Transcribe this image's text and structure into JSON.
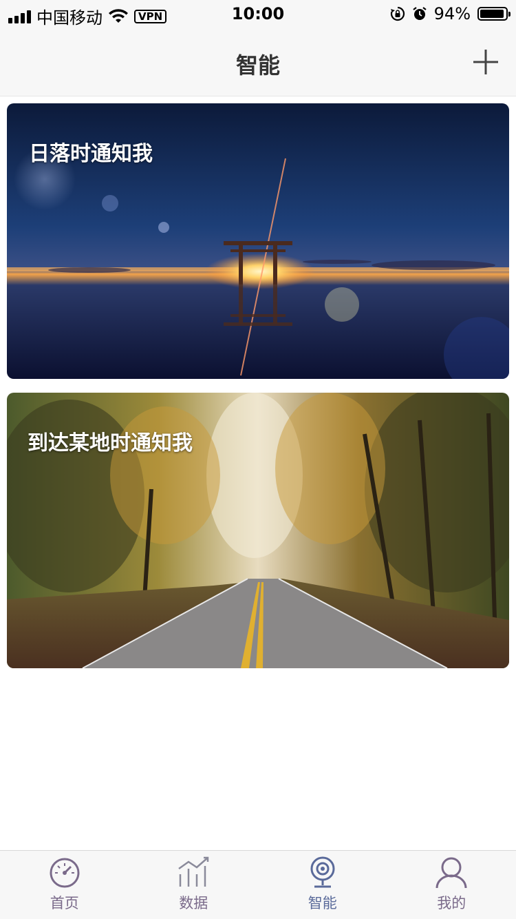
{
  "status_bar": {
    "carrier": "中国移动",
    "vpn": "VPN",
    "time": "10:00",
    "battery": "94%",
    "battery_level": 0.94
  },
  "nav": {
    "title": "智能",
    "add_icon": "plus-icon"
  },
  "cards": [
    {
      "label": "日落时通知我",
      "image": "sunset-torii-lake"
    },
    {
      "label": "到达某地时通知我",
      "image": "autumn-forest-road"
    }
  ],
  "tabs": [
    {
      "label": "首页",
      "icon": "speedometer-icon",
      "active": false
    },
    {
      "label": "数据",
      "icon": "bar-trend-icon",
      "active": false
    },
    {
      "label": "智能",
      "icon": "webcam-icon",
      "active": true
    },
    {
      "label": "我的",
      "icon": "person-icon",
      "active": false
    }
  ],
  "colors": {
    "tab_inactive": "#7a6a8a",
    "tab_active": "#5a6a9a",
    "bar_background": "#f7f7f7"
  }
}
